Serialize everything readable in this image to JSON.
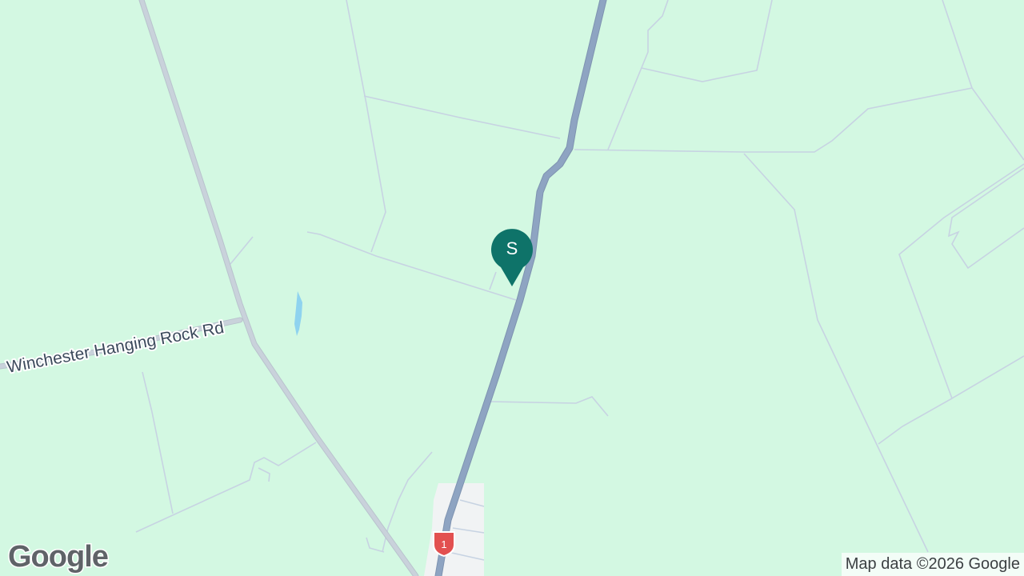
{
  "map": {
    "road_label": "Winchester Hanging Rock Rd",
    "marker_letter": "S",
    "route_shield": "1",
    "attribution": "Map data ©2026 Google",
    "logo": "Google",
    "colors": {
      "land": "#d3f8e2",
      "highway": "#8ea4c2",
      "road": "#c9d2db",
      "minor_road": "#c7d3e2",
      "marker": "#0e7369",
      "water": "#8fd3ef",
      "shield": "#e25050",
      "town": "#f1f3f4"
    }
  }
}
